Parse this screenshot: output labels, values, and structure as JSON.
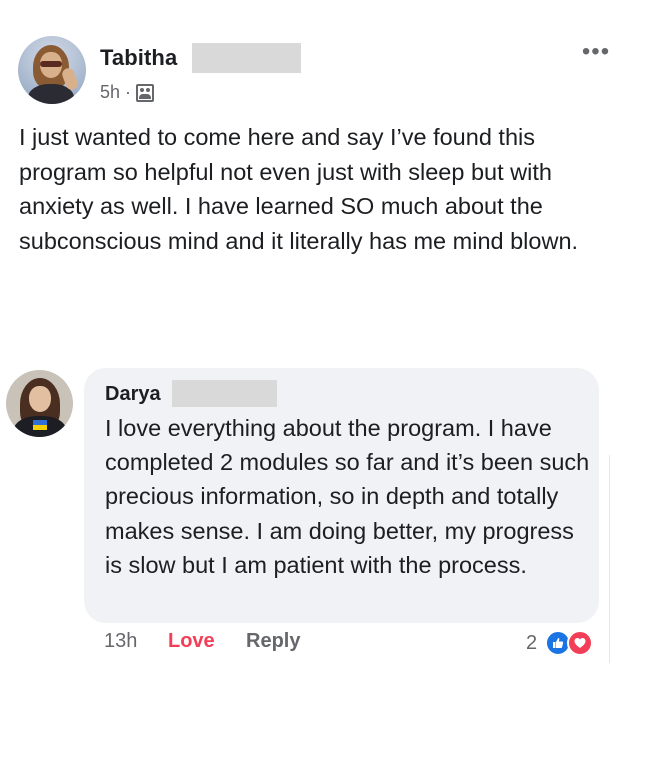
{
  "post": {
    "author": "Tabitha",
    "time": "5h",
    "separator": "·",
    "audience_icon": "friends-icon",
    "more_icon": "•••",
    "body": "I just wanted to come here and say I’ve found this program so helpful not even just with sleep but with anxiety as well. I have learned SO much about the subconscious mind and it literally has me mind blown."
  },
  "comment": {
    "author": "Darya",
    "body": "I love everything about the program. I have completed 2 modules so far and it’s been such precious information, so in depth and totally makes sense. I am doing better, my progress is slow but I am patient with the process.",
    "time": "13h",
    "love_label": "Love",
    "reply_label": "Reply",
    "reaction_count": "2",
    "reactions": [
      "like-icon",
      "love-icon"
    ]
  },
  "colors": {
    "text": "#1c1e21",
    "secondary": "#65676b",
    "bubble": "#f0f2f5",
    "love": "#f33e58",
    "like": "#1b74e4",
    "redaction": "#d9d9d9"
  }
}
